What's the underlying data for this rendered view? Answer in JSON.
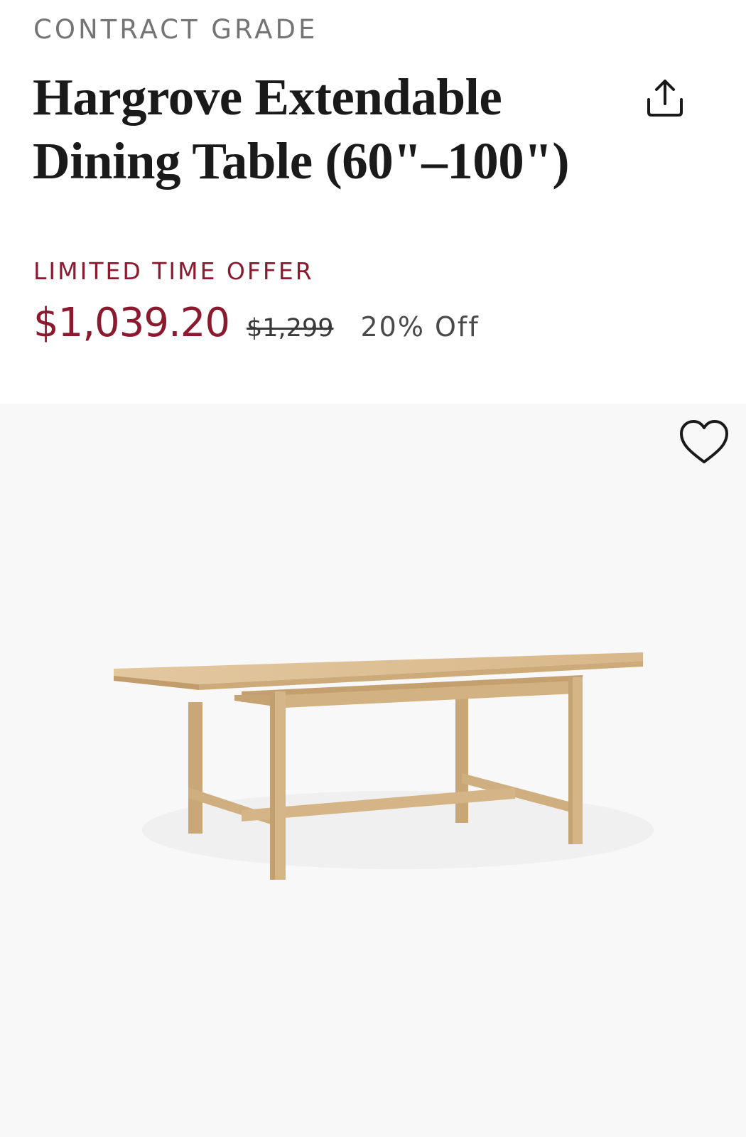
{
  "product": {
    "eyebrow": "CONTRACT GRADE",
    "title_line1": "Hargrove Extendable",
    "title_line2": "Dining Table (60\"–100\")"
  },
  "pricing": {
    "offer_label": "LIMITED TIME OFFER",
    "sale_price": "$1,039.20",
    "original_price": "$1,299",
    "discount": "20% Off"
  },
  "colors": {
    "accent": "#8b1a2e",
    "image_background": "#f8f8f8",
    "wood": "#d9b98a"
  },
  "icons": {
    "share": "share-icon",
    "favorite": "heart-icon"
  }
}
